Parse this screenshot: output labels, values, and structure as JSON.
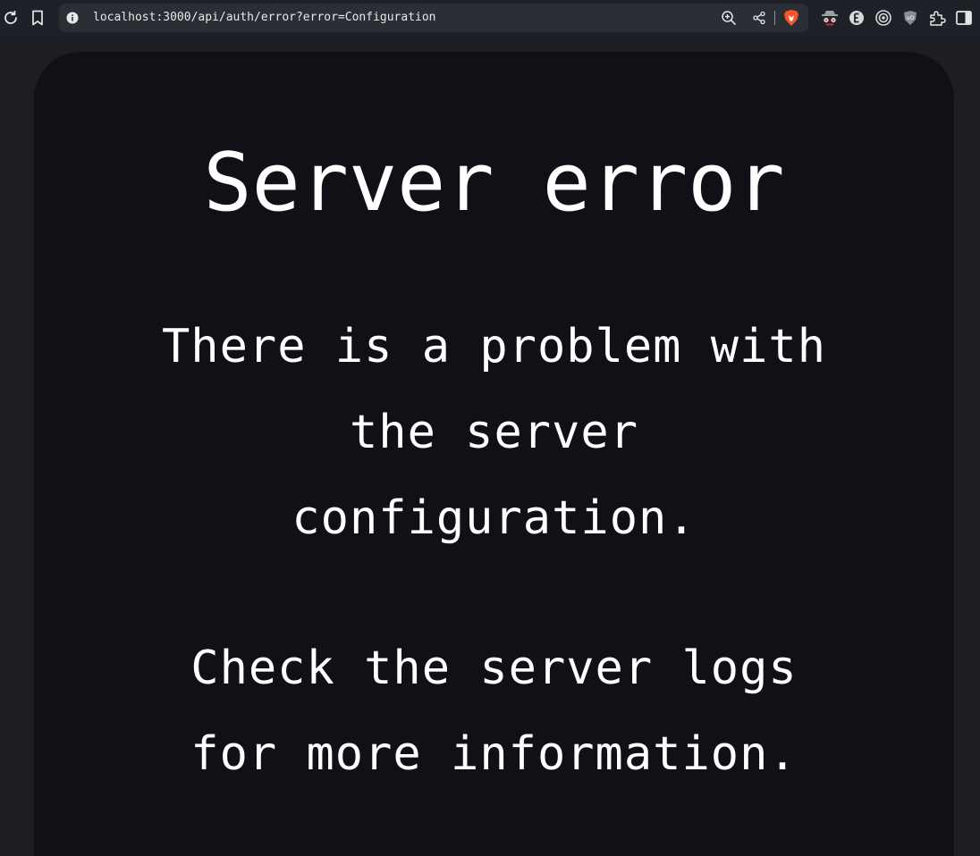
{
  "browser": {
    "url": "localhost:3000/api/auth/error?error=Configuration",
    "icons": {
      "reload": "reload-icon",
      "bookmark": "bookmark-icon",
      "site_info": "info-icon",
      "zoom": "zoom-in-icon",
      "share": "share-icon",
      "brave": "brave-shields-icon",
      "extensions": [
        "incognito-glasses-icon",
        "extension-e-icon",
        "target-icon",
        "ublock-origin-icon",
        "puzzle-extensions-icon",
        "sidebar-toggle-icon"
      ]
    },
    "colors": {
      "toolbar_bg": "#1f2128",
      "urlbar_bg": "#2c2e35",
      "brave_orange": "#fb542b"
    }
  },
  "page": {
    "title": "Server error",
    "message": "There is a problem with the server configuration.",
    "hint": "Check the server logs for more information.",
    "colors": {
      "page_bg": "#1c1e24",
      "card_bg": "#0f1117",
      "text": "#ffffff"
    }
  }
}
